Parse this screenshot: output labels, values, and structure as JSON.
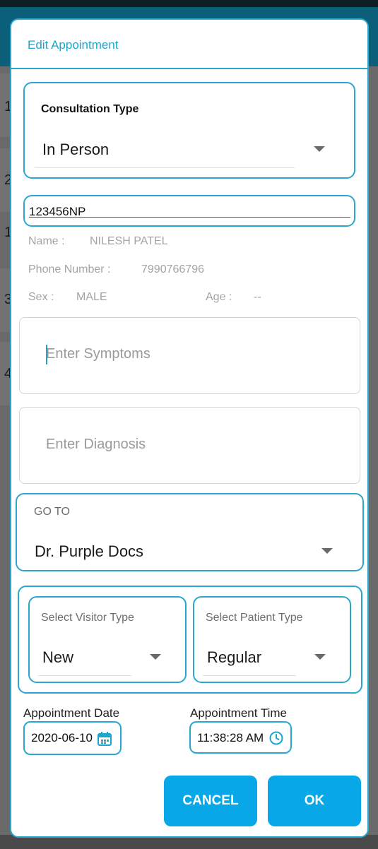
{
  "background": {
    "list_numbers": [
      "1",
      "2",
      "1",
      "3",
      "4"
    ]
  },
  "dialog": {
    "title": "Edit Appointment",
    "consultation": {
      "label": "Consultation Type",
      "value": "In Person"
    },
    "patient_id": "123456NP",
    "patient_info": {
      "name_label": "Name :",
      "name_value": "NILESH PATEL",
      "phone_label": "Phone Number :",
      "phone_value": "7990766796",
      "sex_label": "Sex :",
      "sex_value": "MALE",
      "age_label": "Age :",
      "age_value": "--"
    },
    "symptoms_placeholder": "Enter Symptoms",
    "diagnosis_placeholder": "Enter Diagnosis",
    "goto": {
      "label": "GO TO",
      "value": "Dr. Purple Docs"
    },
    "visitor_type": {
      "label": "Select Visitor Type",
      "value": "New"
    },
    "patient_type": {
      "label": "Select Patient Type",
      "value": "Regular"
    },
    "appointment_date": {
      "label": "Appointment Date",
      "value": "2020-06-10",
      "icon": "calendar-icon"
    },
    "appointment_time": {
      "label": "Appointment Time",
      "value": "11:38:28 AM",
      "icon": "clock-icon"
    },
    "buttons": {
      "cancel": "CANCEL",
      "ok": "OK"
    }
  },
  "colors": {
    "accent": "#29a7cf",
    "button": "#08a8e8"
  }
}
